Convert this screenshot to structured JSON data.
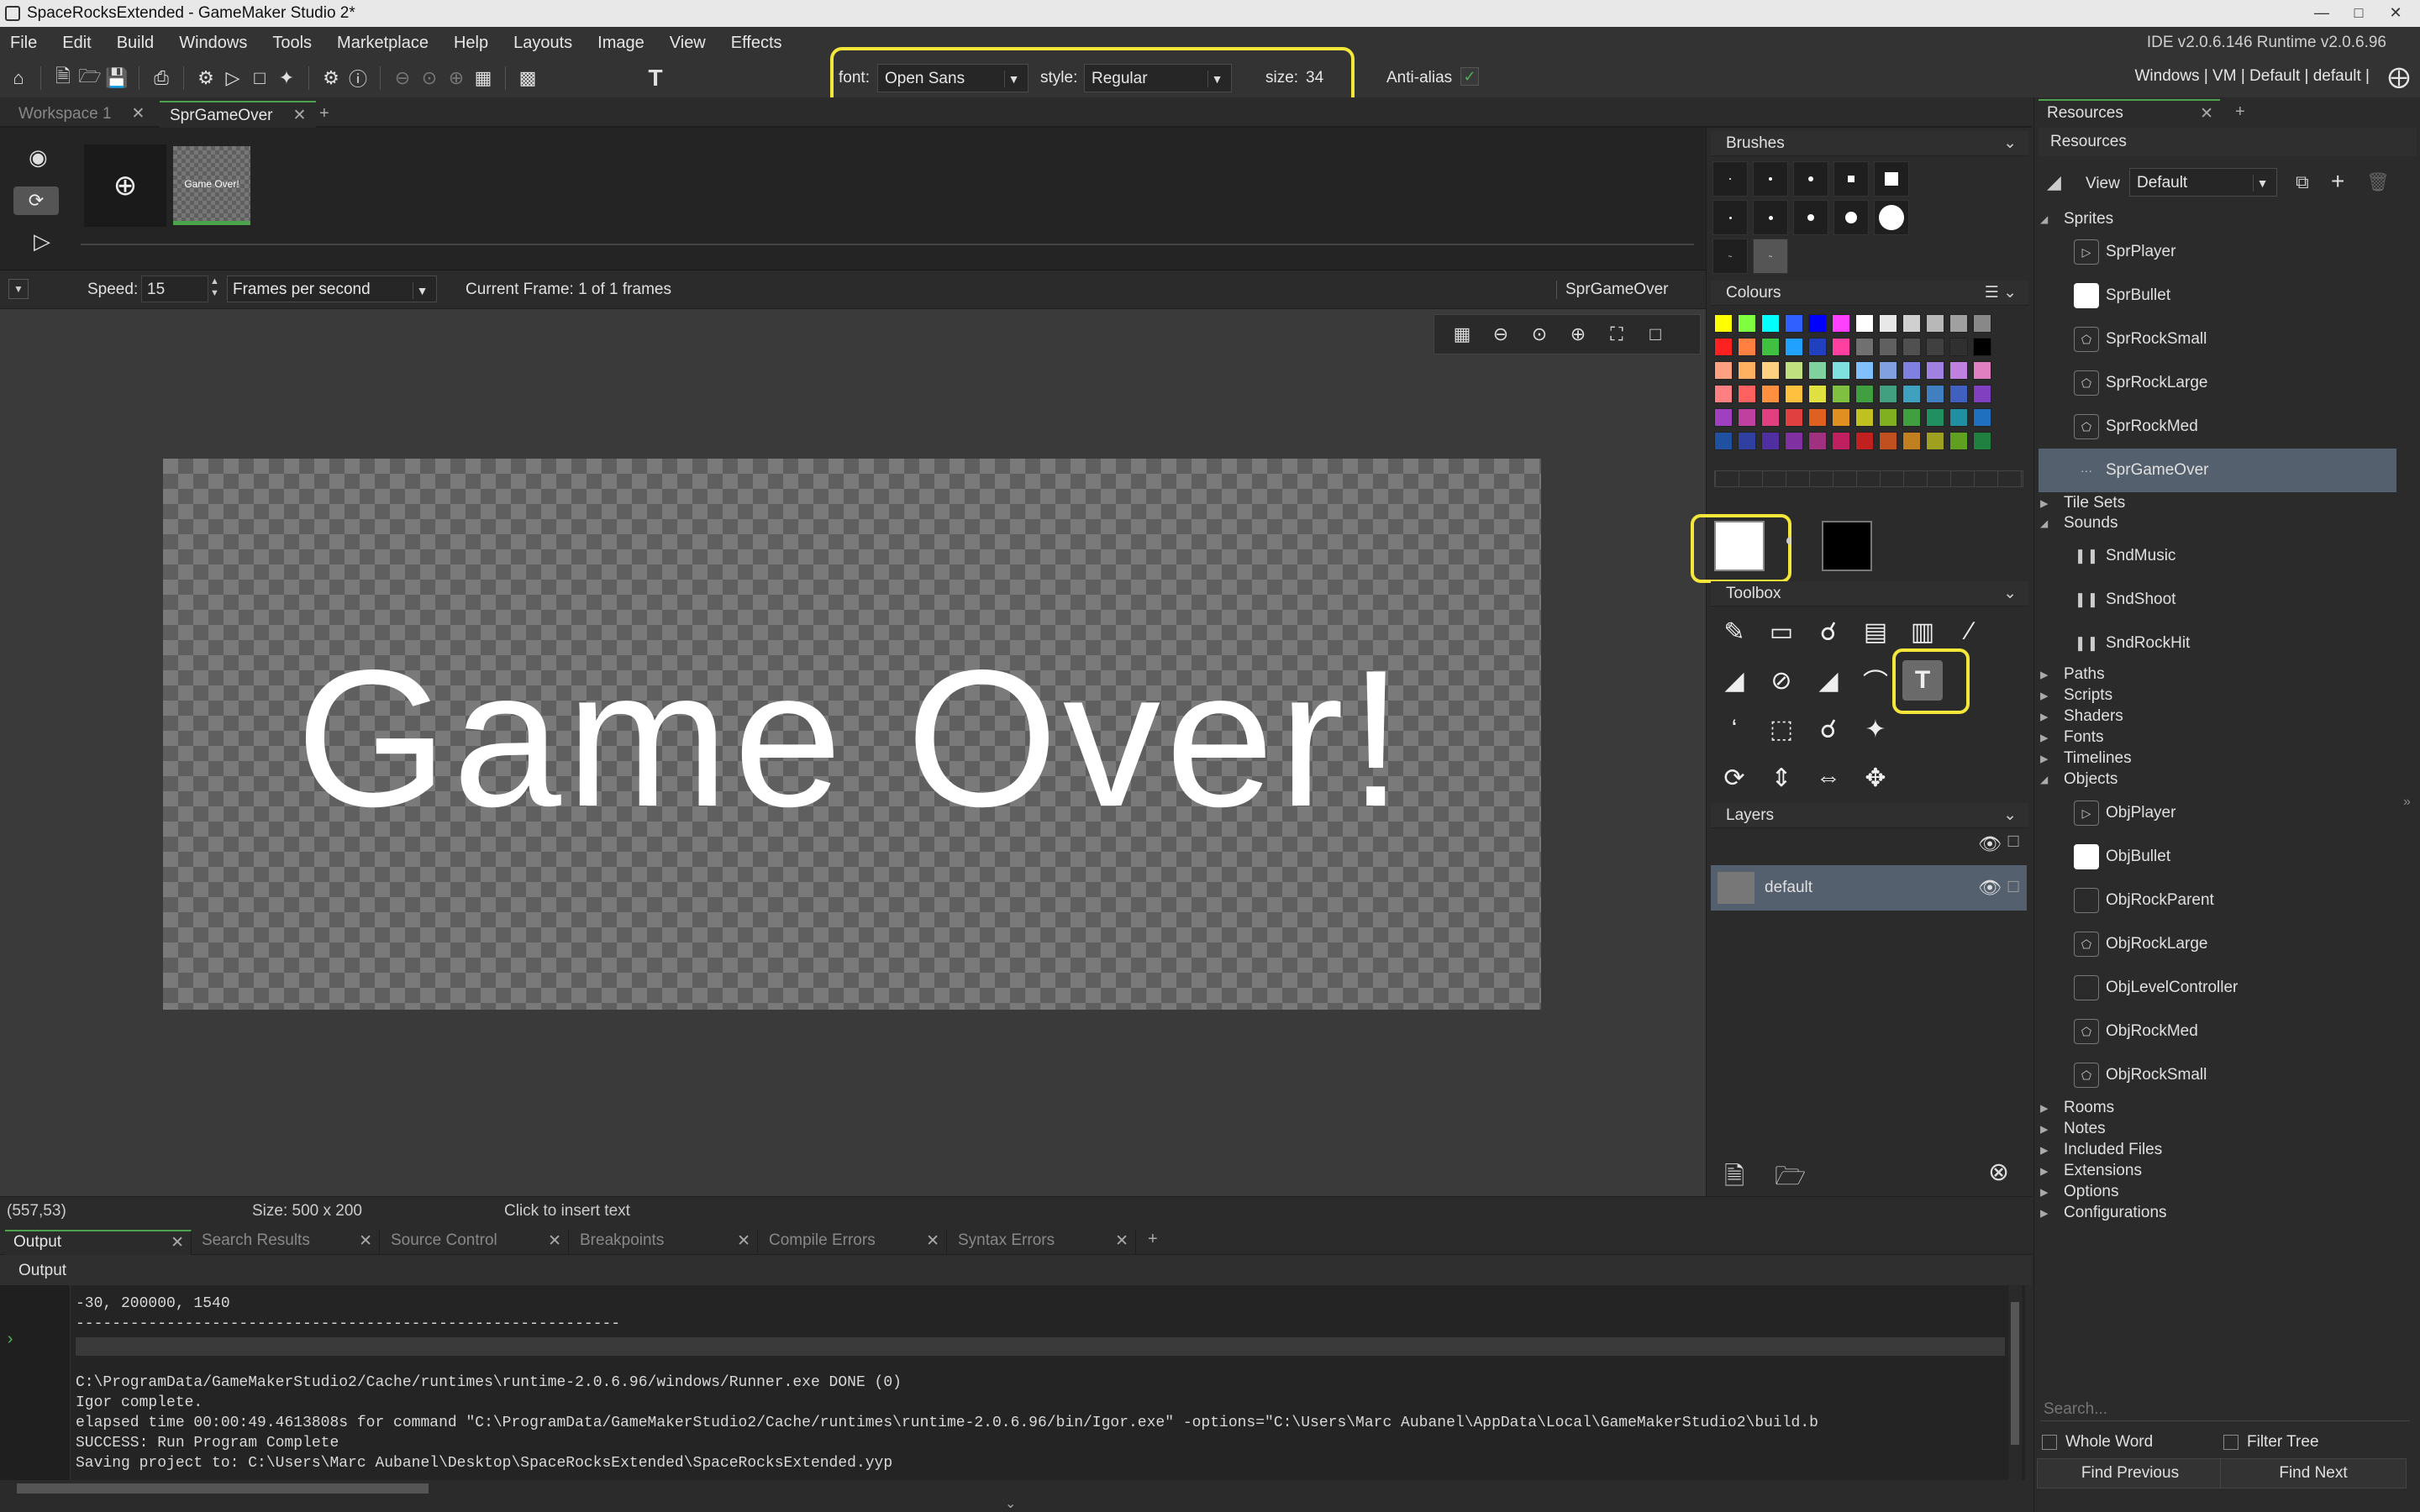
{
  "window": {
    "title": "SpaceRocksExtended - GameMaker Studio 2*",
    "version": "IDE v2.0.6.146 Runtime v2.0.6.96"
  },
  "menu": [
    "File",
    "Edit",
    "Build",
    "Windows",
    "Tools",
    "Marketplace",
    "Help",
    "Layouts",
    "Image",
    "View",
    "Effects"
  ],
  "toolbar": {
    "right_text": "Windows | VM | Default | default |",
    "text_options": {
      "font_label": "font:",
      "font_value": "Open Sans",
      "style_label": "style:",
      "style_value": "Regular",
      "size_label": "size:",
      "size_value": "34",
      "antialias_label": "Anti-alias",
      "antialias_checked": true
    }
  },
  "tabs": [
    {
      "label": "Workspace 1"
    },
    {
      "label": "SprGameOver"
    }
  ],
  "frames": {
    "thumb_label": "Game Over!"
  },
  "speed": {
    "label": "Speed:",
    "value": "15",
    "unit": "Frames per second",
    "current_frame": "Current Frame: 1 of 1 frames",
    "sprite_name": "SprGameOver"
  },
  "canvas": {
    "text": "Game Over!"
  },
  "status": {
    "coords": "(557,53)",
    "size": "Size: 500 x 200",
    "hint": "Click to insert text"
  },
  "panels": {
    "brushes": "Brushes",
    "colours": "Colours",
    "toolbox": "Toolbox",
    "layers": "Layers",
    "layer_name": "default"
  },
  "colors": {
    "accent_yellow": "#f5e63a",
    "palette_rows": [
      [
        "#ffff00",
        "#80ff40",
        "#00ffff",
        "#3060ff",
        "#0000ff",
        "#ff40ff",
        "#ffffff",
        "#e8e8e8",
        "#d0d0d0",
        "#b8b8b8",
        "#a0a0a0",
        "#888888"
      ],
      [
        "#ff2020",
        "#ff8040",
        "#40c040",
        "#20a0ff",
        "#2040c0",
        "#ff40a0",
        "#707070",
        "#606060",
        "#505050",
        "#404040",
        "#303030",
        "#000000"
      ],
      [
        "#ffa080",
        "#ffb060",
        "#ffd080",
        "#c0e080",
        "#80d0a0",
        "#80e0e0",
        "#80c0ff",
        "#80a0e0",
        "#8080e0",
        "#a080e0",
        "#c080e0",
        "#e080c0"
      ],
      [
        "#ff8080",
        "#ff6060",
        "#ff9040",
        "#ffc040",
        "#e0e040",
        "#80c040",
        "#40a040",
        "#40a080",
        "#40a0c0",
        "#4080c0",
        "#4060c0",
        "#8040c0"
      ],
      [
        "#a040c0",
        "#c040a0",
        "#e04080",
        "#e04040",
        "#e06020",
        "#e09020",
        "#c0c020",
        "#80b020",
        "#40a040",
        "#209060",
        "#2090a0",
        "#2070c0"
      ],
      [
        "#2050a0",
        "#3040a0",
        "#5030a0",
        "#8030a0",
        "#a03080",
        "#c02060",
        "#c02020",
        "#c05020",
        "#c08020",
        "#a0a020",
        "#60a020",
        "#208040"
      ]
    ]
  },
  "resources": {
    "tab": "Resources",
    "header": "Resources",
    "view_label": "View",
    "view_value": "Default",
    "groups": [
      {
        "label": "Sprites",
        "open": true
      },
      {
        "label": "Tile Sets",
        "open": false
      },
      {
        "label": "Sounds",
        "open": true
      },
      {
        "label": "Paths",
        "open": false
      },
      {
        "label": "Scripts",
        "open": false
      },
      {
        "label": "Shaders",
        "open": false
      },
      {
        "label": "Fonts",
        "open": false
      },
      {
        "label": "Timelines",
        "open": false
      },
      {
        "label": "Objects",
        "open": true
      },
      {
        "label": "Rooms",
        "open": false
      },
      {
        "label": "Notes",
        "open": false
      },
      {
        "label": "Included Files",
        "open": false
      },
      {
        "label": "Extensions",
        "open": false
      },
      {
        "label": "Options",
        "open": false
      },
      {
        "label": "Configurations",
        "open": false
      }
    ],
    "sprites": [
      "SprPlayer",
      "SprBullet",
      "SprRockSmall",
      "SprRockLarge",
      "SprRockMed",
      "SprGameOver"
    ],
    "sounds": [
      "SndMusic",
      "SndShoot",
      "SndRockHit"
    ],
    "objects": [
      "ObjPlayer",
      "ObjBullet",
      "ObjRockParent",
      "ObjRockLarge",
      "ObjLevelController",
      "ObjRockMed",
      "ObjRockSmall"
    ],
    "search_placeholder": "Search...",
    "whole_word": "Whole Word",
    "filter_tree": "Filter Tree",
    "find_previous": "Find Previous",
    "find_next": "Find Next"
  },
  "output": {
    "tabs": [
      "Output",
      "Search Results",
      "Source Control",
      "Breakpoints",
      "Compile Errors",
      "Syntax Errors"
    ],
    "header": "Output",
    "lines": [
      "-30, 200000, 1540",
      "------------------------------------------------------------",
      "",
      "C:\\ProgramData/GameMakerStudio2/Cache/runtimes\\runtime-2.0.6.96/windows/Runner.exe DONE (0)",
      "Igor complete.",
      "elapsed time 00:00:49.4613808s for command \"C:\\ProgramData/GameMakerStudio2/Cache/runtimes\\runtime-2.0.6.96/bin/Igor.exe\" -options=\"C:\\Users\\Marc Aubanel\\AppData\\Local\\GameMakerStudio2\\build.b",
      "SUCCESS: Run Program Complete",
      "Saving project to: C:\\Users\\Marc Aubanel\\Desktop\\SpaceRocksExtended\\SpaceRocksExtended.yyp"
    ]
  }
}
